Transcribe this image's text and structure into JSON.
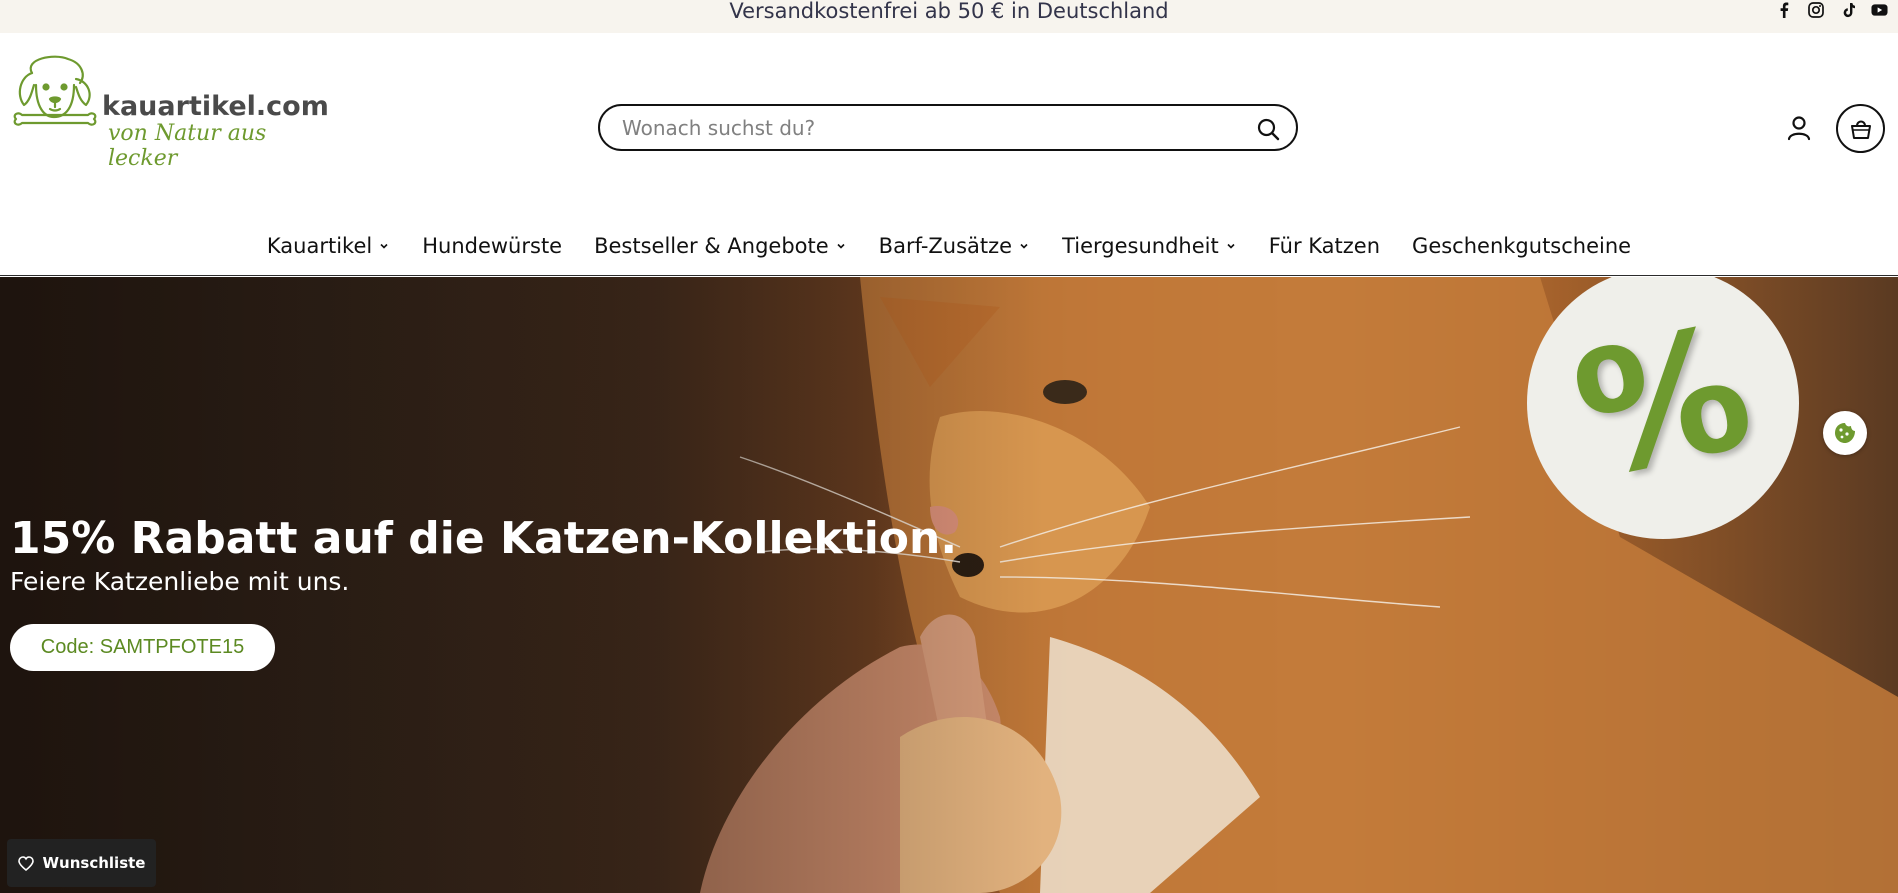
{
  "announcement": {
    "text": "Versandkostenfrei ab 50 € in Deutschland"
  },
  "social": [
    {
      "icon": "facebook-icon"
    },
    {
      "icon": "instagram-icon"
    },
    {
      "icon": "tiktok-icon"
    },
    {
      "icon": "youtube-icon"
    }
  ],
  "brand": {
    "name": "kauartikel.com",
    "slogan": "von Natur aus lecker",
    "accent_color": "#6e9a2f"
  },
  "search": {
    "placeholder": "Wonach suchst du?"
  },
  "nav": [
    {
      "label": "Kauartikel",
      "has_dropdown": true
    },
    {
      "label": "Hundewürste",
      "has_dropdown": false
    },
    {
      "label": "Bestseller & Angebote",
      "has_dropdown": true
    },
    {
      "label": "Barf-Zusätze",
      "has_dropdown": true
    },
    {
      "label": "Tiergesundheit",
      "has_dropdown": true
    },
    {
      "label": "Für Katzen",
      "has_dropdown": false
    },
    {
      "label": "Geschenkgutscheine",
      "has_dropdown": false
    }
  ],
  "hero": {
    "title_bold": "15%",
    "title_rest": " Rabatt auf die Katzen-Kollektion.",
    "subtitle": "Feiere Katzenliebe mit uns.",
    "cta_label": "Code: SAMTPFOTE15",
    "badge": "%"
  },
  "wishlist": {
    "label": "Wunschliste"
  }
}
